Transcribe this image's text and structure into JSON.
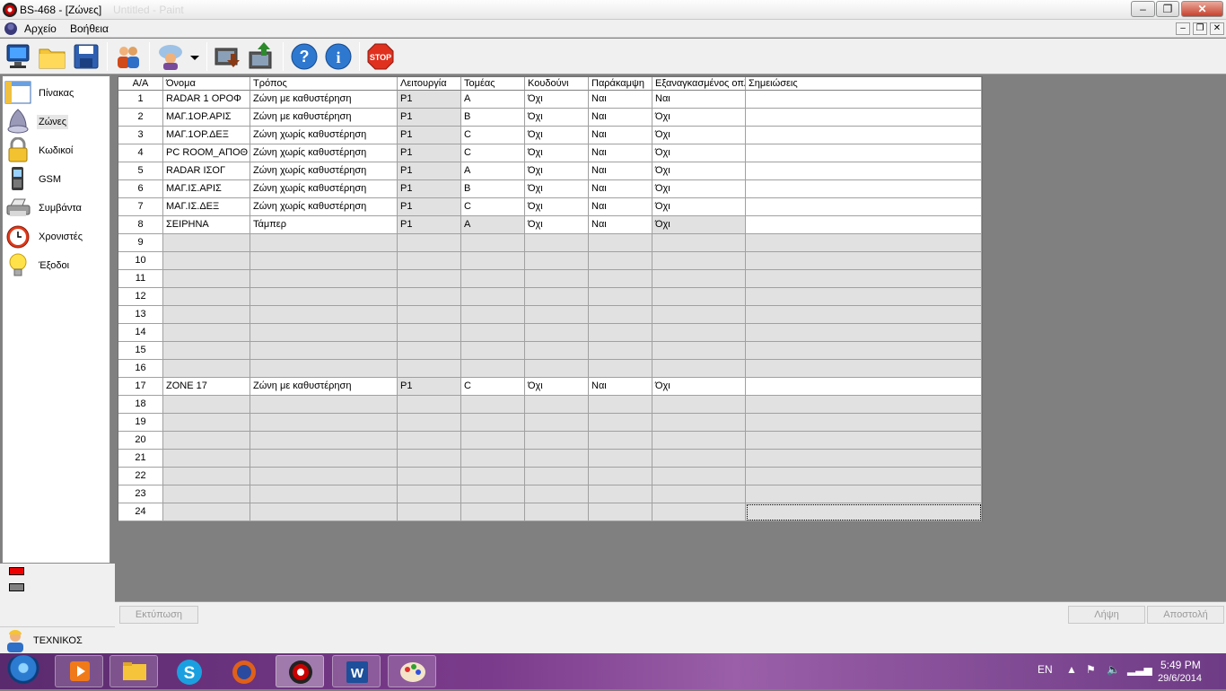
{
  "window": {
    "title": "BS-468 - [Ζώνες]",
    "faint_title": "Untitled - Paint"
  },
  "menu": {
    "file": "Αρχείο",
    "help": "Βοήθεια"
  },
  "sidebar": {
    "items": [
      {
        "label": "Πίνακας",
        "icon": "table-icon"
      },
      {
        "label": "Ζώνες",
        "icon": "zone-bell-icon"
      },
      {
        "label": "Κωδικοί",
        "icon": "padlock-icon"
      },
      {
        "label": "GSM",
        "icon": "mobile-phone-icon"
      },
      {
        "label": "Συμβάντα",
        "icon": "printer-icon"
      },
      {
        "label": "Χρονιστές",
        "icon": "alarm-clock-icon"
      },
      {
        "label": "Έξοδοι",
        "icon": "light-bulb-icon"
      }
    ]
  },
  "user": {
    "name": "ΤΕΧΝΙΚΟΣ"
  },
  "table": {
    "headers": [
      "Α/Α",
      "Όνομα",
      "Τρόπος",
      "Λειτουργία",
      "Τομέας",
      "Κουδούνι",
      "Παράκαμψη",
      "Εξαναγκασμένος οπλισμός",
      "Σημειώσεις"
    ],
    "rows": [
      [
        "1",
        "RADAR 1 ΟΡΟΦ",
        "Ζώνη με καθυστέρηση",
        "P1",
        "A",
        "Όχι",
        "Ναι",
        "Ναι",
        ""
      ],
      [
        "2",
        "ΜΑΓ.1ΟΡ.ΑΡΙΣ",
        "Ζώνη με καθυστέρηση",
        "P1",
        "B",
        "Όχι",
        "Ναι",
        "Όχι",
        ""
      ],
      [
        "3",
        "ΜΑΓ.1ΟΡ.ΔΕΞ",
        "Ζώνη χωρίς καθυστέρηση",
        "P1",
        "C",
        "Όχι",
        "Ναι",
        "Όχι",
        ""
      ],
      [
        "4",
        "PC ROOM_ΑΠΟΘ",
        "Ζώνη χωρίς καθυστέρηση",
        "P1",
        "C",
        "Όχι",
        "Ναι",
        "Όχι",
        ""
      ],
      [
        "5",
        "RADAR ΙΣΟΓ",
        "Ζώνη χωρίς καθυστέρηση",
        "P1",
        "A",
        "Όχι",
        "Ναι",
        "Όχι",
        ""
      ],
      [
        "6",
        "ΜΑΓ.ΙΣ.ΑΡΙΣ",
        "Ζώνη χωρίς καθυστέρηση",
        "P1",
        "B",
        "Όχι",
        "Ναι",
        "Όχι",
        ""
      ],
      [
        "7",
        "ΜΑΓ.ΙΣ.ΔΕΞ",
        "Ζώνη χωρίς καθυστέρηση",
        "P1",
        "C",
        "Όχι",
        "Ναι",
        "Όχι",
        ""
      ],
      [
        "8",
        "ΣΕΙΡΗΝΑ",
        "Τάμπερ",
        "P1",
        "A",
        "Όχι",
        "Ναι",
        "Όχι",
        ""
      ],
      [
        "9",
        "",
        "",
        "",
        "",
        "",
        "",
        "",
        ""
      ],
      [
        "10",
        "",
        "",
        "",
        "",
        "",
        "",
        "",
        ""
      ],
      [
        "11",
        "",
        "",
        "",
        "",
        "",
        "",
        "",
        ""
      ],
      [
        "12",
        "",
        "",
        "",
        "",
        "",
        "",
        "",
        ""
      ],
      [
        "13",
        "",
        "",
        "",
        "",
        "",
        "",
        "",
        ""
      ],
      [
        "14",
        "",
        "",
        "",
        "",
        "",
        "",
        "",
        ""
      ],
      [
        "15",
        "",
        "",
        "",
        "",
        "",
        "",
        "",
        ""
      ],
      [
        "16",
        "",
        "",
        "",
        "",
        "",
        "",
        "",
        ""
      ],
      [
        "17",
        "ZONE 17",
        "Ζώνη με καθυστέρηση",
        "P1",
        "C",
        "Όχι",
        "Ναι",
        "Όχι",
        ""
      ],
      [
        "18",
        "",
        "",
        "",
        "",
        "",
        "",
        "",
        ""
      ],
      [
        "19",
        "",
        "",
        "",
        "",
        "",
        "",
        "",
        ""
      ],
      [
        "20",
        "",
        "",
        "",
        "",
        "",
        "",
        "",
        ""
      ],
      [
        "21",
        "",
        "",
        "",
        "",
        "",
        "",
        "",
        ""
      ],
      [
        "22",
        "",
        "",
        "",
        "",
        "",
        "",
        "",
        ""
      ],
      [
        "23",
        "",
        "",
        "",
        "",
        "",
        "",
        "",
        ""
      ],
      [
        "24",
        "",
        "",
        "",
        "",
        "",
        "",
        "",
        ""
      ]
    ]
  },
  "buttons": {
    "print": "Εκτύπωση",
    "receive": "Λήψη",
    "send": "Αποστολή"
  },
  "tray": {
    "language": "EN",
    "time": "5:49 PM",
    "date": "29/6/2014"
  },
  "colors": {
    "legend_red": "#ee0000",
    "legend_gray": "#808080"
  }
}
